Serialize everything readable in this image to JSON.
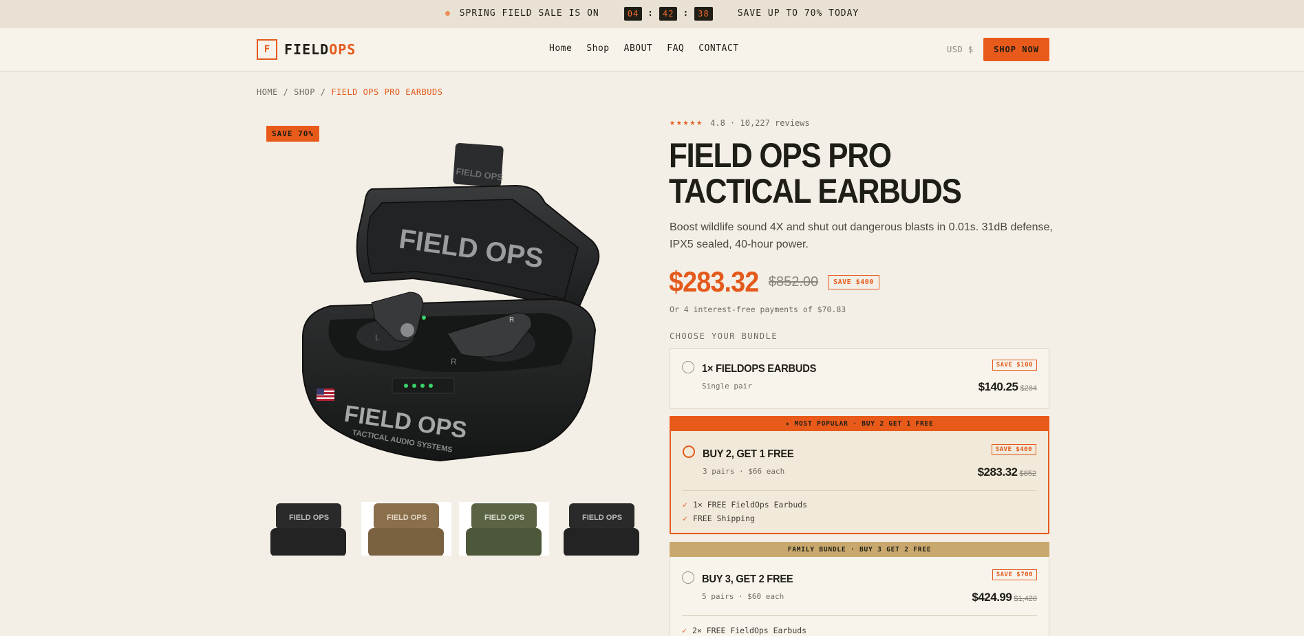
{
  "salebar": {
    "text": "SPRING FIELD SALE IS ON",
    "hours": "04",
    "minutes": "42",
    "seconds": "38",
    "sep": ":",
    "promo": "SAVE UP TO 70% TODAY"
  },
  "header": {
    "logo_mark": "F",
    "logo_text_a": "FIELD",
    "logo_text_b": "OPS",
    "nav": [
      "Home",
      "Shop",
      "ABOUT",
      "FAQ",
      "CONTACT"
    ],
    "currency": "USD $",
    "cta": "SHOP NOW"
  },
  "breadcrumb": {
    "items": [
      "HOME",
      "SHOP"
    ],
    "sep": "/",
    "current": "FIELD OPS PRO EARBUDS"
  },
  "gallery": {
    "badge": "SAVE 70%",
    "case_lid_text": "FIELD OPS",
    "case_front_text": "FIELD OPS",
    "case_sub_text": "TACTICAL AUDIO SYSTEMS",
    "bud_left": "L",
    "bud_right": "R",
    "tab_text": "FIELD OPS",
    "thumb_text": "FIELD OPS",
    "thumb_colors": [
      "#2a2a2a",
      "#8a6f4c",
      "#5a6445",
      "#2a2a2a"
    ]
  },
  "product": {
    "stars": "★★★★★",
    "rating": "4.8 · 10,227 reviews",
    "title_line1": "FIELD OPS PRO",
    "title_line2": "TACTICAL EARBUDS",
    "description": "Boost wildlife sound 4X and shut out dangerous blasts in 0.01s. 31dB defense, IPX5 sealed, 40-hour power.",
    "price": "$283.32",
    "old_price": "$852.00",
    "save_tag": "SAVE $400",
    "installments": "Or 4 interest-free payments of $70.83",
    "bundle_label": "CHOOSE YOUR BUNDLE"
  },
  "bundles": [
    {
      "name": "1× FIELDOPS EARBUDS",
      "sub": "Single pair",
      "tag": "SAVE $100",
      "price": "$140.25",
      "old": "$284"
    },
    {
      "banner": "★ MOST POPULAR · BUY 2 GET 1 FREE",
      "name": "BUY 2, GET 1 FREE",
      "sub": "3 pairs · $66 each",
      "tag": "SAVE $400",
      "price": "$283.32",
      "old": "$852",
      "check": "✓",
      "perks": [
        "1× FREE FieldOps Earbuds",
        "FREE Shipping"
      ]
    },
    {
      "banner": "FAMILY BUNDLE · BUY 3 GET 2 FREE",
      "name": "BUY 3, GET 2 FREE",
      "sub": "5 pairs · $60 each",
      "tag": "SAVE $700",
      "price": "$424.99",
      "old": "$1,420",
      "check": "✓",
      "perks": [
        "2× FREE FieldOps Earbuds"
      ]
    }
  ]
}
